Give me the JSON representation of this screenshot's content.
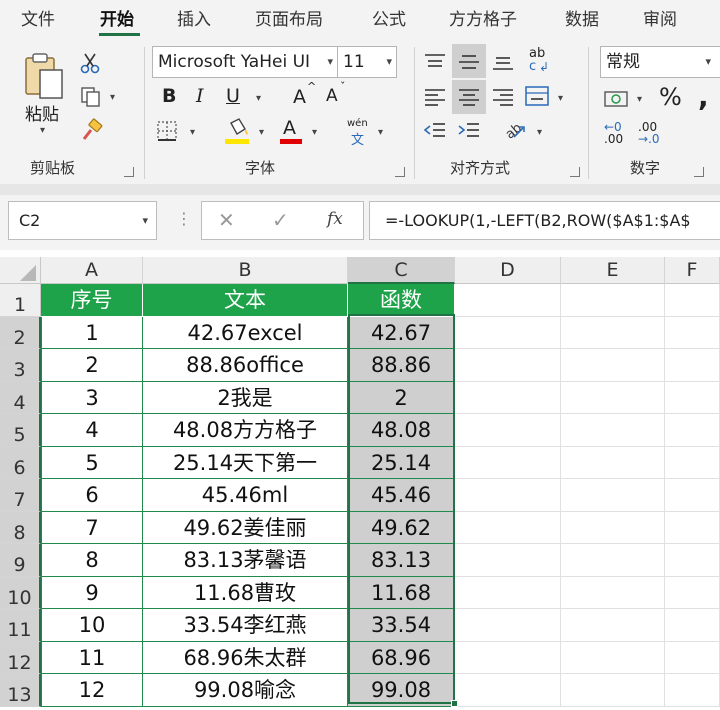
{
  "menu": {
    "tabs": [
      "文件",
      "开始",
      "插入",
      "页面布局",
      "公式",
      "方方格子",
      "数据",
      "审阅"
    ],
    "active": "开始"
  },
  "ribbon": {
    "clipboard": {
      "label": "剪贴板",
      "paste": "粘贴"
    },
    "font": {
      "label": "字体",
      "name": "Microsoft YaHei UI",
      "size": "11",
      "bold": "B",
      "italic": "I",
      "underline": "U",
      "grow": "A",
      "shrink": "A",
      "font_color": "A",
      "phonetic_top": "wén",
      "phonetic_bottom": "文"
    },
    "alignment": {
      "label": "对齐方式",
      "wrap_top": "ab",
      "wrap_bottom": "c"
    },
    "number": {
      "label": "数字",
      "format": "常规",
      "percent": "%",
      "inc_decimal_top": "←0",
      "inc_decimal_bottom": ".00",
      "dec_decimal_top": ".00",
      "dec_decimal_bottom": "→.0"
    }
  },
  "formula_bar": {
    "name_box": "C2",
    "fx": "fx",
    "formula": "=-LOOKUP(1,-LEFT(B2,ROW($A$1:$A$"
  },
  "columns": [
    "A",
    "B",
    "C",
    "D",
    "E",
    "F"
  ],
  "rows": [
    "1",
    "2",
    "3",
    "4",
    "5",
    "6",
    "7",
    "8",
    "9",
    "10",
    "11",
    "12",
    "13"
  ],
  "table": {
    "header": [
      "序号",
      "文本",
      "函数"
    ],
    "data": [
      [
        "1",
        "42.67excel",
        "42.67"
      ],
      [
        "2",
        "88.86office",
        "88.86"
      ],
      [
        "3",
        "2我是",
        "2"
      ],
      [
        "4",
        "48.08方方格子",
        "48.08"
      ],
      [
        "5",
        "25.14天下第一",
        "25.14"
      ],
      [
        "6",
        "45.46ml",
        "45.46"
      ],
      [
        "7",
        "49.62姜佳丽",
        "49.62"
      ],
      [
        "8",
        "83.13茅馨语",
        "83.13"
      ],
      [
        "9",
        "11.68曹玫",
        "11.68"
      ],
      [
        "10",
        "33.54李红燕",
        "33.54"
      ],
      [
        "11",
        "68.96朱太群",
        "68.96"
      ],
      [
        "12",
        "99.08喻念",
        "99.08"
      ]
    ]
  },
  "colors": {
    "accent": "#217346",
    "header_fill": "#1fa34a",
    "font_color_bar": "#e00000",
    "highlight_bar": "#ffe600"
  }
}
